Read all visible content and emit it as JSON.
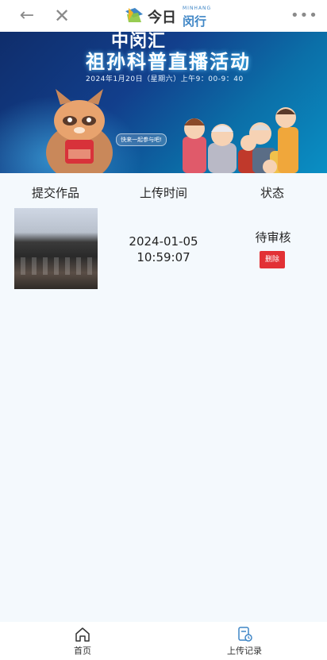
{
  "header": {
    "back_icon": "back-arrow-icon",
    "close_icon": "close-icon",
    "more_icon": "more-icon",
    "logo": {
      "small": "MINHANG",
      "big": "闵行",
      "mark": "今日"
    }
  },
  "banner": {
    "title_line1": "中闵汇",
    "title_line2": "祖孙科普直播活动",
    "date_line": "2024年1月20日（星期六）上午9：00-9：40",
    "join_label": "快来一起参与吧!"
  },
  "table": {
    "headers": [
      "提交作品",
      "上传时间",
      "状态"
    ],
    "rows": [
      {
        "upload_date": "2024-01-05",
        "upload_time": "10:59:07",
        "status": "待审核",
        "delete_label": "删除"
      }
    ]
  },
  "tabbar": {
    "items": [
      {
        "label": "首页",
        "icon": "home-icon"
      },
      {
        "label": "上传记录",
        "icon": "upload-record-icon"
      }
    ]
  },
  "colors": {
    "accent_blue": "#3f86c6",
    "delete_red": "#e23135",
    "page_bg": "#f4f9fd"
  }
}
